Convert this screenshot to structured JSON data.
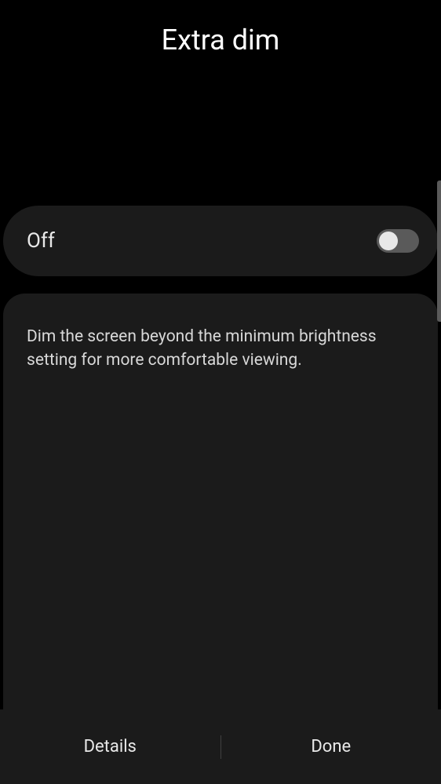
{
  "header": {
    "title": "Extra dim"
  },
  "toggle": {
    "label": "Off",
    "state": false
  },
  "description": {
    "text": "Dim the screen beyond the minimum brightness setting for more comfortable viewing."
  },
  "footer": {
    "details_label": "Details",
    "done_label": "Done"
  }
}
